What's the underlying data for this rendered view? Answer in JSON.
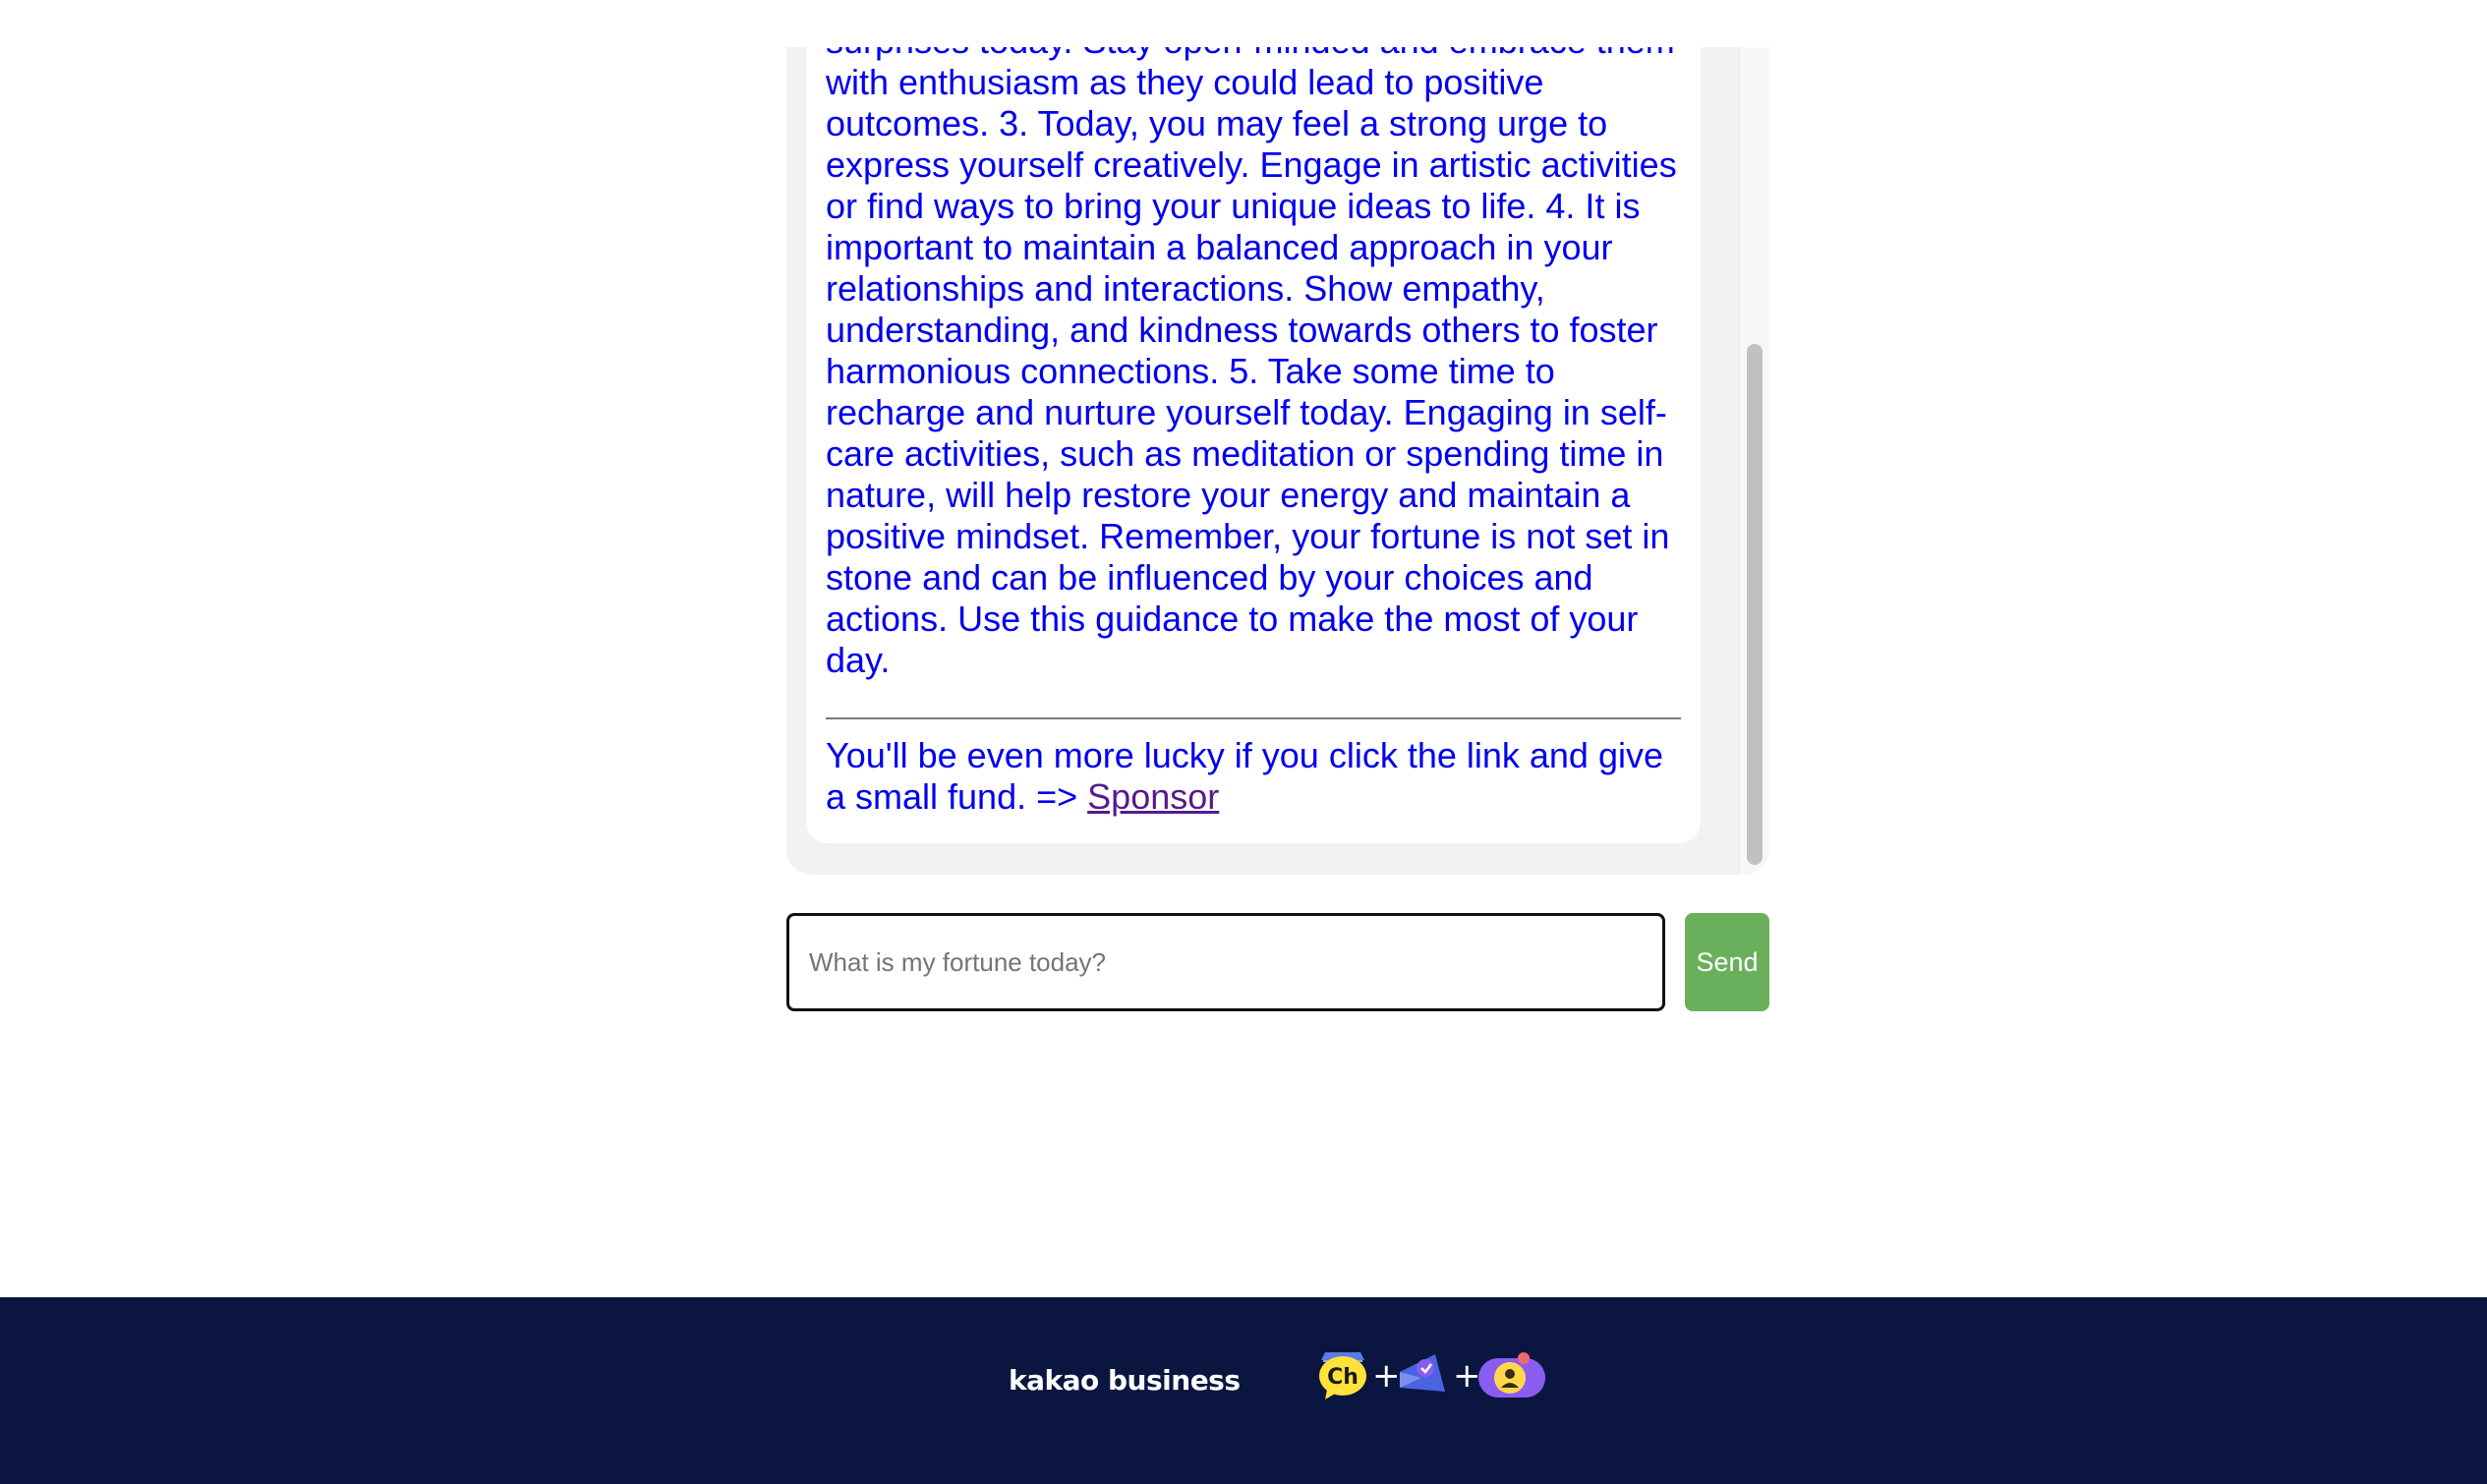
{
  "chat": {
    "response_text": "surprises today. Stay open-minded and embrace them with enthusiasm as they could lead to positive outcomes. 3. Today, you may feel a strong urge to express yourself creatively. Engage in artistic activities or find ways to bring your unique ideas to life. 4. It is important to maintain a balanced approach in your relationships and interactions. Show empathy, understanding, and kindness towards others to foster harmonious connections. 5. Take some time to recharge and nurture yourself today. Engaging in self-care activities, such as meditation or spending time in nature, will help restore your energy and maintain a positive mindset. Remember, your fortune is not set in stone and can be influenced by your choices and actions. Use this guidance to make the most of your day.",
    "sponsor_prefix": "You'll be even more lucky if you click the link and give a small fund. => ",
    "sponsor_link": "Sponsor"
  },
  "input": {
    "placeholder": "What is my fortune today?",
    "value": ""
  },
  "send_label": "Send",
  "footer": {
    "brand": "kakao business",
    "icons": [
      "kakao-channel-icon",
      "kakao-message-ad-icon",
      "kakao-talk-profile-icon"
    ],
    "separator": "+"
  },
  "colors": {
    "message_text": "#0000ee",
    "link_visited": "#551a8b",
    "send_button": "#6ab05c",
    "footer_bg": "#0a1640",
    "chat_bg": "#f2f2f2"
  }
}
